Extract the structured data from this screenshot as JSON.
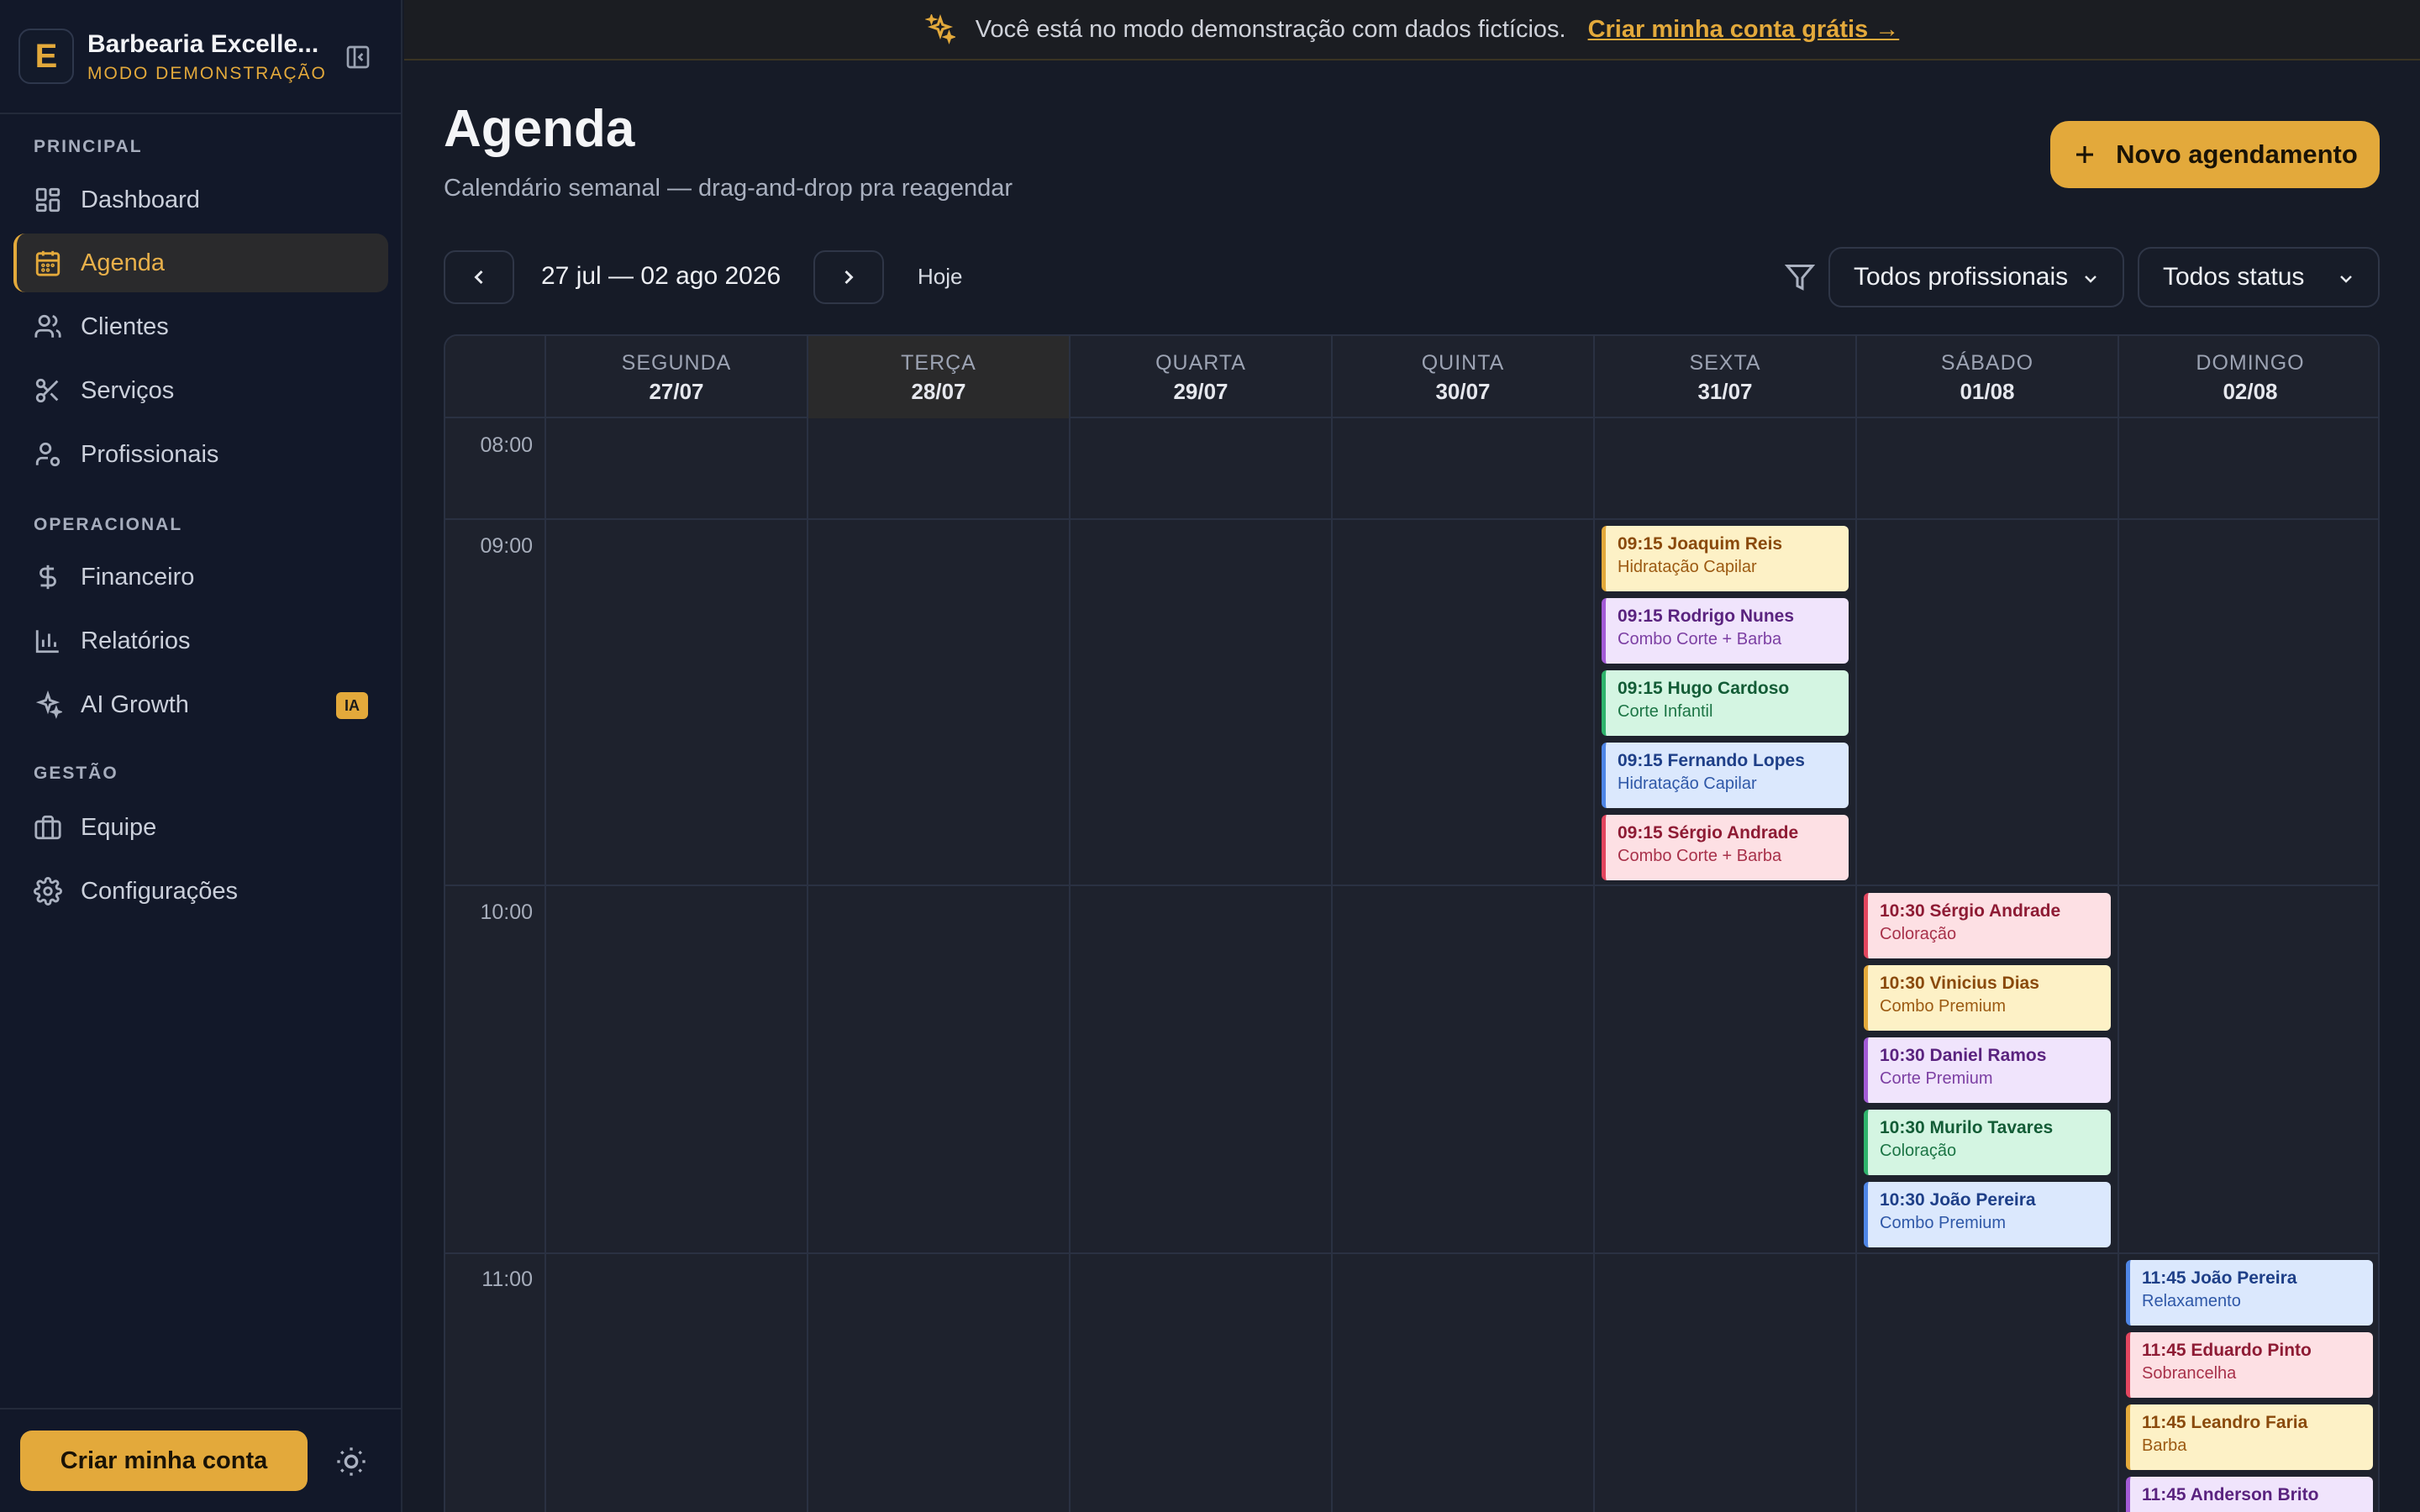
{
  "brand": {
    "logo_letter": "E",
    "name": "Barbearia Excelle...",
    "mode": "MODO DEMONSTRAÇÃO"
  },
  "sidebar": {
    "sections": [
      "PRINCIPAL",
      "OPERACIONAL",
      "GESTÃO"
    ],
    "items": [
      {
        "label": "Dashboard",
        "icon": "dashboard-icon"
      },
      {
        "label": "Agenda",
        "icon": "calendar-icon",
        "active": true
      },
      {
        "label": "Clientes",
        "icon": "users-icon"
      },
      {
        "label": "Serviços",
        "icon": "scissors-icon"
      },
      {
        "label": "Profissionais",
        "icon": "professional-icon"
      },
      {
        "label": "Financeiro",
        "icon": "dollar-icon"
      },
      {
        "label": "Relatórios",
        "icon": "bar-chart-icon"
      },
      {
        "label": "AI Growth",
        "icon": "sparkles-icon",
        "badge": "IA"
      },
      {
        "label": "Equipe",
        "icon": "briefcase-icon"
      },
      {
        "label": "Configurações",
        "icon": "gear-icon"
      }
    ],
    "create_account": "Criar minha conta"
  },
  "banner": {
    "text": "Você está no modo demonstração com dados fictícios.",
    "link": "Criar minha conta grátis →"
  },
  "header": {
    "title": "Agenda",
    "subtitle": "Calendário semanal — drag-and-drop pra reagendar",
    "new_button": "Novo agendamento"
  },
  "toolbar": {
    "date_range": "27 jul — 02 ago 2026",
    "today": "Hoje",
    "professional_filter": "Todos profissionais",
    "status_filter": "Todos status"
  },
  "calendar": {
    "days": [
      {
        "name": "SEGUNDA",
        "date": "27/07"
      },
      {
        "name": "TERÇA",
        "date": "28/07",
        "today": true
      },
      {
        "name": "QUARTA",
        "date": "29/07"
      },
      {
        "name": "QUINTA",
        "date": "30/07"
      },
      {
        "name": "SEXTA",
        "date": "31/07"
      },
      {
        "name": "SÁBADO",
        "date": "01/08"
      },
      {
        "name": "DOMINGO",
        "date": "02/08"
      }
    ],
    "hours": [
      "08:00",
      "09:00",
      "10:00",
      "11:00"
    ],
    "appointments": [
      {
        "day": 4,
        "title": "09:15 Joaquim Reis",
        "service": "Hidratação Capilar",
        "color": "amber"
      },
      {
        "day": 4,
        "title": "09:15 Rodrigo Nunes",
        "service": "Combo Corte + Barba",
        "color": "purple"
      },
      {
        "day": 4,
        "title": "09:15 Hugo Cardoso",
        "service": "Corte Infantil",
        "color": "green"
      },
      {
        "day": 4,
        "title": "09:15 Fernando Lopes",
        "service": "Hidratação Capilar",
        "color": "blue"
      },
      {
        "day": 4,
        "title": "09:15 Sérgio Andrade",
        "service": "Combo Corte + Barba",
        "color": "pink"
      },
      {
        "day": 5,
        "title": "10:30 Sérgio Andrade",
        "service": "Coloração",
        "color": "pink"
      },
      {
        "day": 5,
        "title": "10:30 Vinicius Dias",
        "service": "Combo Premium",
        "color": "amber"
      },
      {
        "day": 5,
        "title": "10:30 Daniel Ramos",
        "service": "Corte Premium",
        "color": "purple"
      },
      {
        "day": 5,
        "title": "10:30 Murilo Tavares",
        "service": "Coloração",
        "color": "green"
      },
      {
        "day": 5,
        "title": "10:30 João Pereira",
        "service": "Combo Premium",
        "color": "blue"
      },
      {
        "day": 6,
        "title": "11:45 João Pereira",
        "service": "Relaxamento",
        "color": "blue"
      },
      {
        "day": 6,
        "title": "11:45 Eduardo Pinto",
        "service": "Sobrancelha",
        "color": "pink"
      },
      {
        "day": 6,
        "title": "11:45 Leandro Faria",
        "service": "Barba",
        "color": "amber"
      },
      {
        "day": 6,
        "title": "11:45 Anderson Brito",
        "service": "",
        "color": "purple"
      }
    ]
  }
}
